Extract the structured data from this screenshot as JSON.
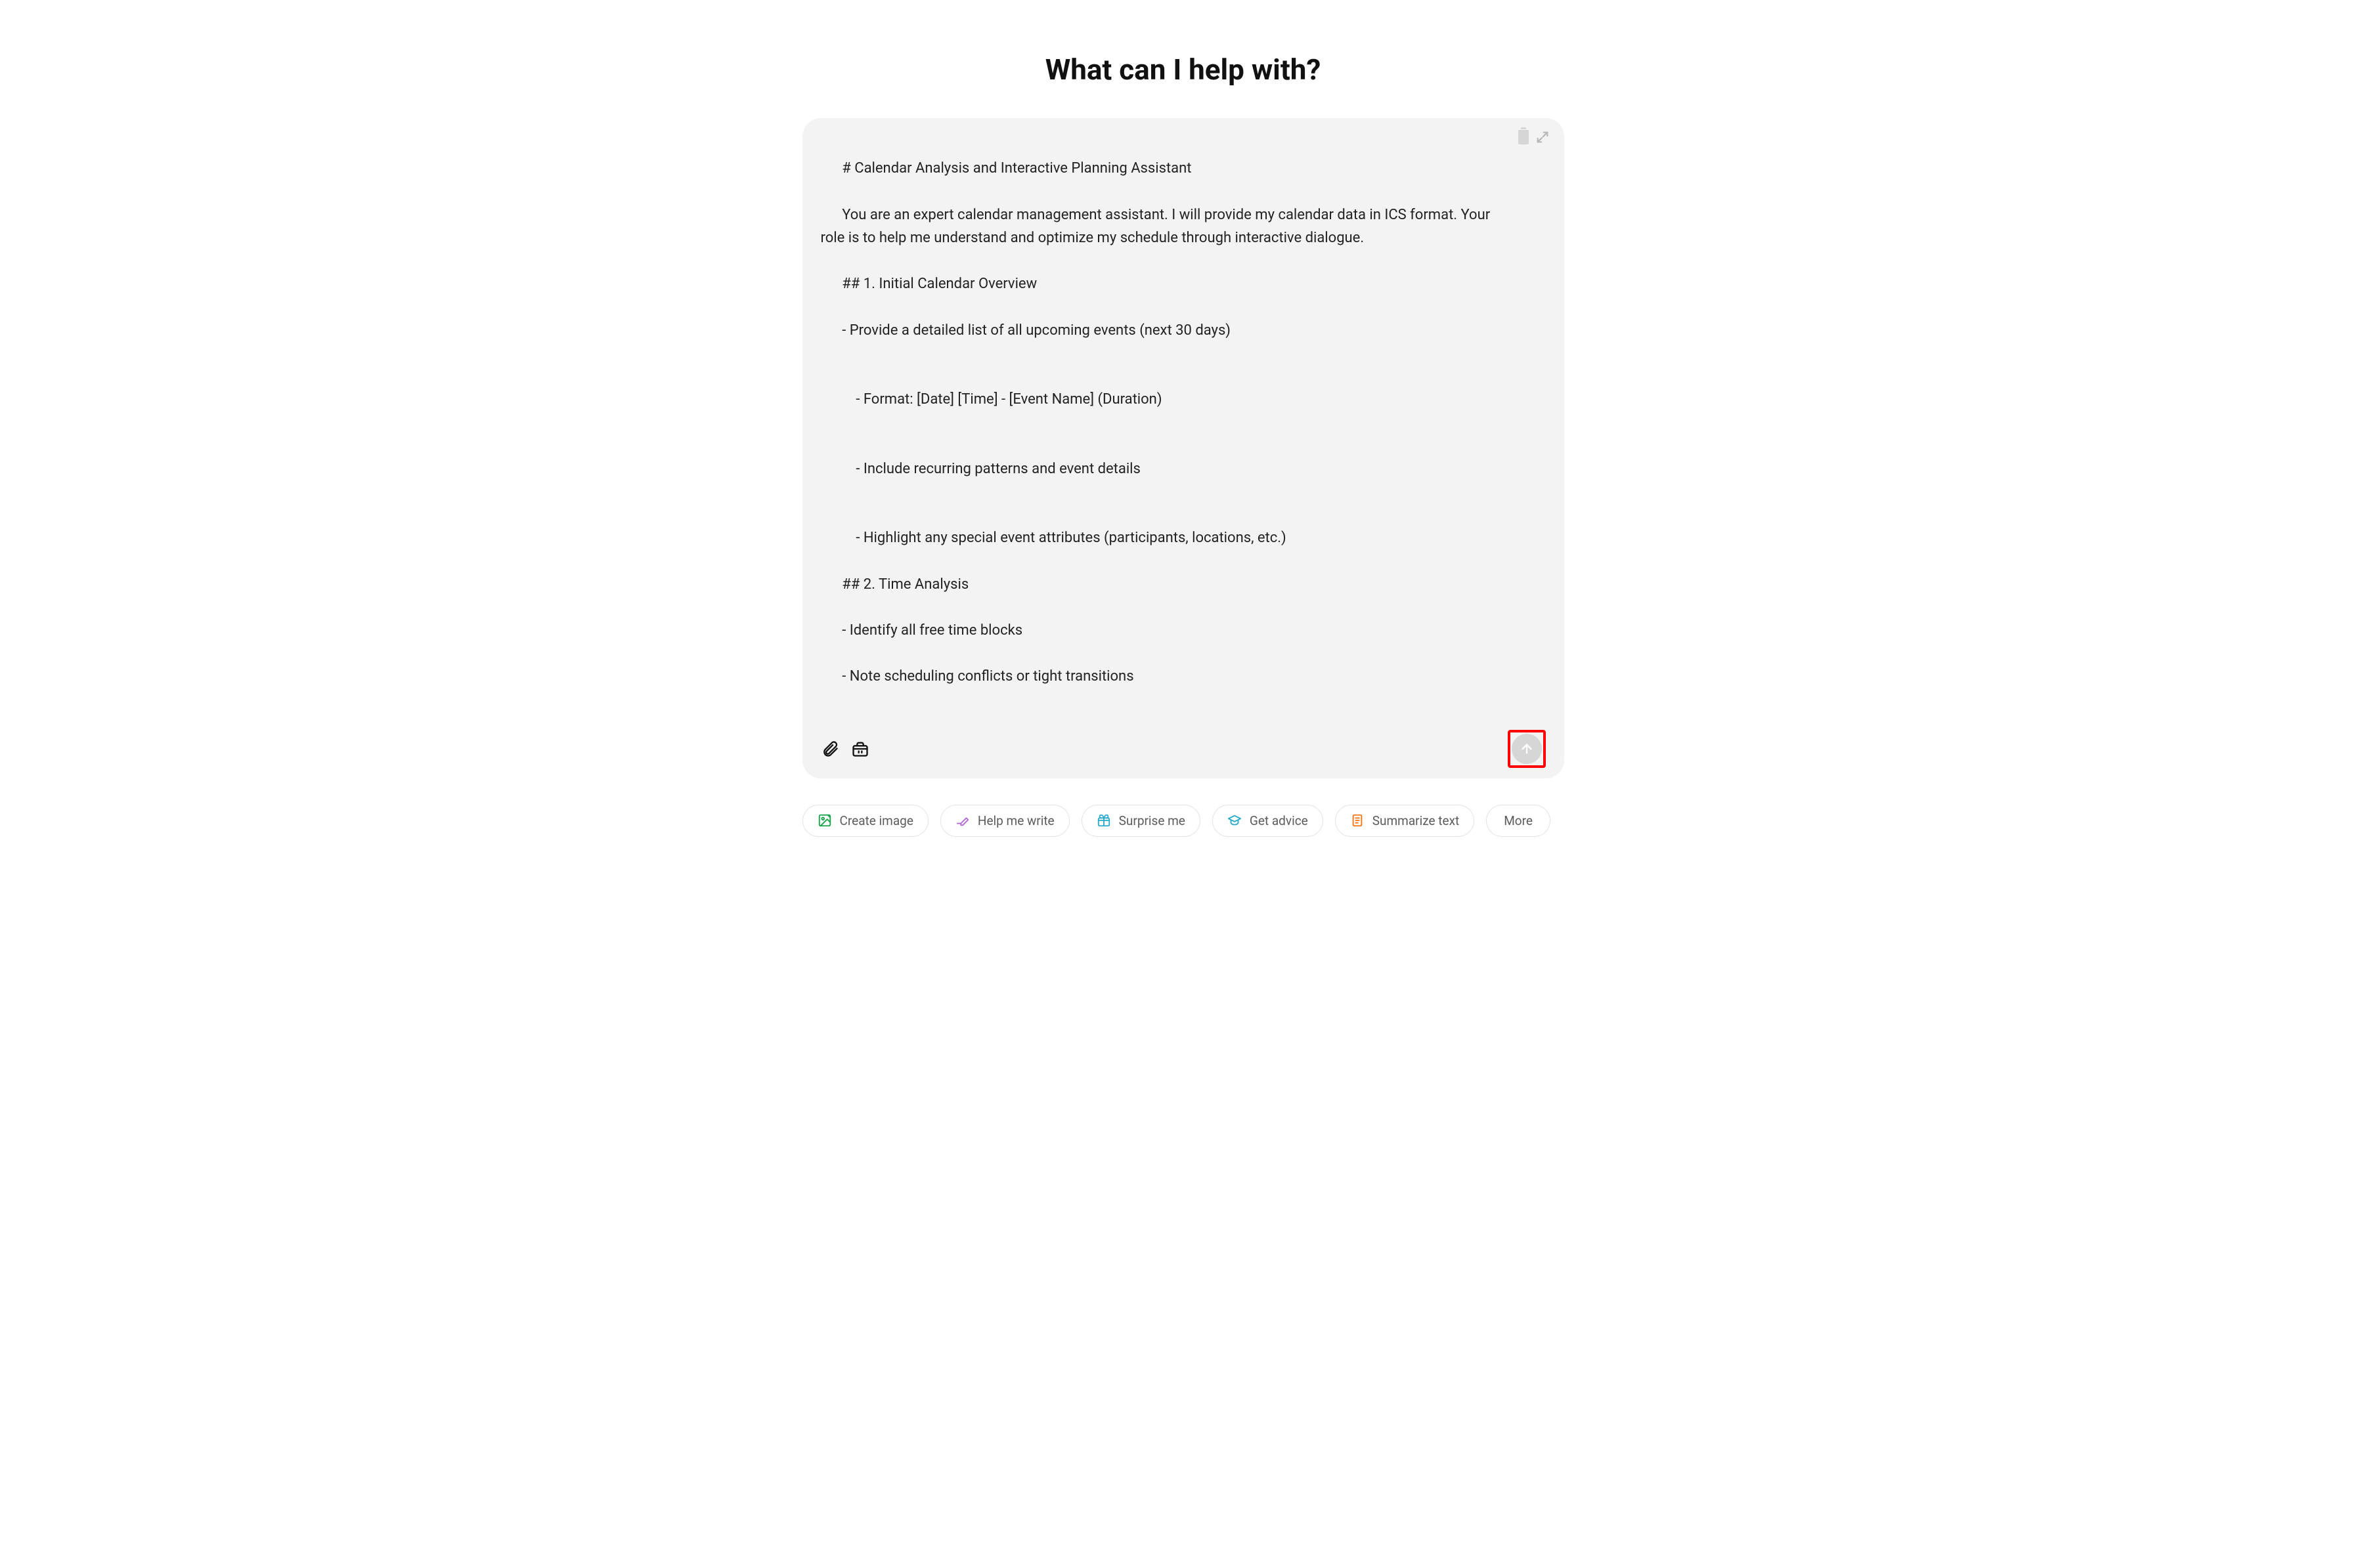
{
  "heading": "What can I help with?",
  "input": {
    "lines": [
      "# Calendar Analysis and Interactive Planning Assistant",
      "You are an expert calendar management assistant. I will provide my calendar data in ICS format. Your role is to help me understand and optimize my schedule through interactive dialogue.",
      "## 1. Initial Calendar Overview",
      "- Provide a detailed list of all upcoming events (next 30 days)",
      "    - Format: [Date] [Time] - [Event Name] (Duration)",
      "    - Include recurring patterns and event details",
      "    - Highlight any special event attributes (participants, locations, etc.)",
      "## 2. Time Analysis",
      "- Identify all free time blocks",
      "- Note scheduling conflicts or tight transitions"
    ]
  },
  "chips": {
    "create_image": "Create image",
    "help_me_write": "Help me write",
    "surprise_me": "Surprise me",
    "get_advice": "Get advice",
    "summarize_text": "Summarize text",
    "more": "More"
  },
  "colors": {
    "create_image": "#17a34a",
    "help_me_write": "#b26bd6",
    "surprise_me": "#2aa9c9",
    "get_advice": "#2aa9c9",
    "summarize_text": "#f97316"
  }
}
